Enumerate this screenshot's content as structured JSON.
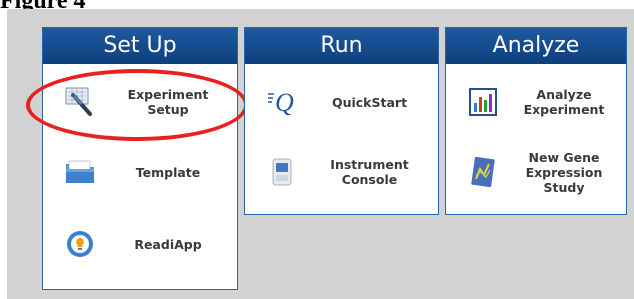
{
  "figure": {
    "label": "Figure 4"
  },
  "panels": [
    {
      "title": "Set Up",
      "items": [
        {
          "label": "Experiment\nSetup",
          "icon": "experiment-setup-icon"
        },
        {
          "label": "Template",
          "icon": "folder-icon"
        },
        {
          "label": "ReadiApp",
          "icon": "readiapp-icon"
        }
      ]
    },
    {
      "title": "Run",
      "items": [
        {
          "label": "QuickStart",
          "icon": "quickstart-q-icon"
        },
        {
          "label": "Instrument\nConsole",
          "icon": "instrument-icon"
        }
      ]
    },
    {
      "title": "Analyze",
      "items": [
        {
          "label": "Analyze\nExperiment",
          "icon": "analyze-chart-icon"
        },
        {
          "label": "New Gene\nExpression\nStudy",
          "icon": "gene-expression-notebook-icon"
        }
      ]
    }
  ],
  "colors": {
    "header": "#1e5aa0",
    "highlight": "#e8211c",
    "canvas": "#d2d2d2"
  }
}
